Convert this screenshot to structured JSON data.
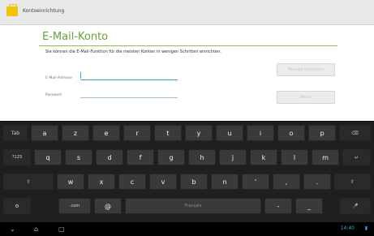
{
  "window": {
    "title": "Kontoeinrichtung"
  },
  "main": {
    "heading": "E-Mail-Konto",
    "description": "Sie können die E-Mail-Funktion für die meisten Konten in wenigen Schritten einrichten.",
    "email_label": "E-Mail-Adresse",
    "email_value": "",
    "password_label": "Passwort",
    "password_value": "",
    "manual_button": "Manuell einrichten",
    "next_button": "Weiter"
  },
  "keyboard": {
    "row1": [
      "Tab",
      "a",
      "z",
      "e",
      "r",
      "t",
      "y",
      "u",
      "i",
      "o",
      "p",
      "⌫"
    ],
    "row2": [
      "?123",
      "q",
      "s",
      "d",
      "f",
      "g",
      "h",
      "j",
      "k",
      "l",
      "m",
      "↵"
    ],
    "row3": [
      "⇧",
      "w",
      "x",
      "c",
      "v",
      "b",
      "n",
      "'",
      ",",
      ".",
      "⇧"
    ],
    "row4": [
      "⚙",
      ".com",
      "@",
      "Français",
      "-",
      "_",
      "🎤"
    ]
  },
  "statusbar": {
    "time": "14:40"
  },
  "colors": {
    "accent_green": "#62a33a",
    "accent_blue": "#38a9d9"
  }
}
